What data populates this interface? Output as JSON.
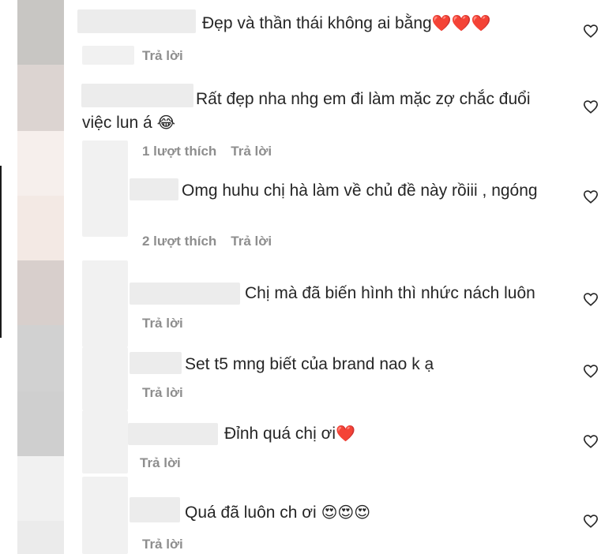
{
  "avatars": [
    "#c8c6c3",
    "#dcd4d1",
    "#f6efec",
    "#f3e9e4",
    "#d8cfcc",
    "#d1d1d1",
    "#cfcfcf",
    "#f1f1f1",
    "#ebebeb"
  ],
  "comments": [
    {
      "text": "Đẹp và thần thái không ai bằng",
      "emoji": "❤️❤️❤️",
      "meta": {
        "likes": "",
        "reply": "Trả lời"
      }
    },
    {
      "text": "Rất đẹp nha nhg em đi làm mặc zợ chắc đuổi",
      "text2": "việc lun á",
      "emoji": "😂",
      "meta": {
        "likes": "1 lượt thích",
        "reply": "Trả lời"
      }
    },
    {
      "text": "Omg huhu chị hà làm về chủ đề này rồiii , ngóng",
      "emoji": "",
      "meta": {
        "likes": "2 lượt thích",
        "reply": "Trả lời"
      }
    },
    {
      "text": "Chị mà đã biến hình thì nhức nách luôn",
      "emoji": "",
      "meta": {
        "likes": "",
        "reply": "Trả lời"
      }
    },
    {
      "text": "Set t5 mng biết của brand nao k ạ",
      "emoji": "",
      "meta": {
        "likes": "",
        "reply": "Trả lời"
      }
    },
    {
      "text": "Đỉnh quá chị ơi",
      "emoji": "❤️",
      "meta": {
        "likes": "",
        "reply": "Trả lời"
      }
    },
    {
      "text": "Quá đã luôn ch ơi",
      "emoji": "😍😍😍",
      "meta": {
        "likes": "",
        "reply": "Trả lời"
      }
    }
  ],
  "icons": {
    "like": "heart-outline-icon"
  }
}
